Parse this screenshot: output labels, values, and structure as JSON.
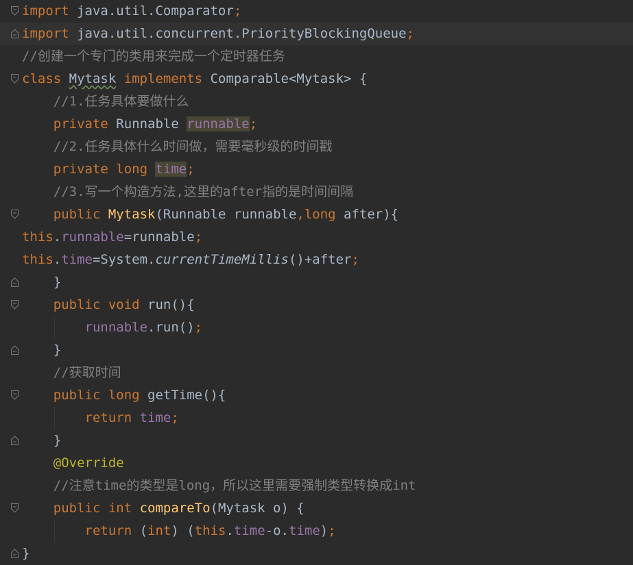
{
  "editor": {
    "lines": [
      {
        "segments": [
          {
            "c": "kw",
            "t": "import"
          },
          {
            "c": "plain",
            "t": " java.util.Comparator"
          },
          {
            "c": "kw",
            "t": ";"
          }
        ]
      },
      {
        "segments": [
          {
            "c": "kw",
            "t": "import"
          },
          {
            "c": "plain",
            "t": " java.util.concurrent.PriorityBlockingQueue"
          },
          {
            "c": "kw",
            "t": ";"
          }
        ]
      },
      {
        "segments": [
          {
            "c": "comment",
            "t": "//创建一个专门的类用来完成一个定时器任务"
          }
        ]
      },
      {
        "segments": [
          {
            "c": "kw",
            "t": "class "
          },
          {
            "c": "plain typo",
            "t": "Mytask"
          },
          {
            "c": "kw",
            "t": " implements "
          },
          {
            "c": "plain",
            "t": "Comparable<Mytask> {"
          }
        ]
      },
      {
        "segments": [
          {
            "c": "comment",
            "t": "    //1.任务具体要做什么"
          }
        ]
      },
      {
        "segments": [
          {
            "c": "kw",
            "t": "    private "
          },
          {
            "c": "plain",
            "t": "Runnable "
          },
          {
            "c": "field hl-usage",
            "t": "runnable"
          },
          {
            "c": "kw",
            "t": ";"
          }
        ]
      },
      {
        "segments": [
          {
            "c": "comment",
            "t": "    //2.任务具体什么时间做，需要毫秒级的时间戳"
          }
        ]
      },
      {
        "segments": [
          {
            "c": "kw",
            "t": "    private long "
          },
          {
            "c": "field hl-usage",
            "t": "time"
          },
          {
            "c": "kw",
            "t": ";"
          }
        ]
      },
      {
        "segments": [
          {
            "c": "comment",
            "t": "    //3.写一个构造方法,这里的after指的是时间间隔"
          }
        ]
      },
      {
        "segments": [
          {
            "c": "kw",
            "t": "    public "
          },
          {
            "c": "method",
            "t": "Mytask"
          },
          {
            "c": "plain",
            "t": "(Runnable runnable"
          },
          {
            "c": "kw",
            "t": ",long "
          },
          {
            "c": "plain",
            "t": "after){"
          }
        ]
      },
      {
        "segments": [
          {
            "c": "kw",
            "t": "this"
          },
          {
            "c": "plain",
            "t": "."
          },
          {
            "c": "field",
            "t": "runnable"
          },
          {
            "c": "plain",
            "t": "=runnable"
          },
          {
            "c": "kw",
            "t": ";"
          }
        ]
      },
      {
        "segments": [
          {
            "c": "kw",
            "t": "this"
          },
          {
            "c": "plain",
            "t": "."
          },
          {
            "c": "field",
            "t": "time"
          },
          {
            "c": "plain",
            "t": "=System."
          },
          {
            "c": "static-call",
            "t": "currentTimeMillis"
          },
          {
            "c": "plain",
            "t": "()+after"
          },
          {
            "c": "kw",
            "t": ";"
          }
        ]
      },
      {
        "segments": [
          {
            "c": "plain",
            "t": "    }"
          }
        ]
      },
      {
        "segments": [
          {
            "c": "kw",
            "t": "    public void "
          },
          {
            "c": "plain",
            "t": "run(){"
          }
        ]
      },
      {
        "segments": [
          {
            "c": "field",
            "t": "        runnable"
          },
          {
            "c": "plain",
            "t": ".run()"
          },
          {
            "c": "kw",
            "t": ";"
          }
        ]
      },
      {
        "segments": [
          {
            "c": "plain",
            "t": "    }"
          }
        ]
      },
      {
        "segments": [
          {
            "c": "comment",
            "t": "    //获取时间"
          }
        ]
      },
      {
        "segments": [
          {
            "c": "kw",
            "t": "    public long "
          },
          {
            "c": "plain",
            "t": "getTime(){"
          }
        ]
      },
      {
        "segments": [
          {
            "c": "kw",
            "t": "        return "
          },
          {
            "c": "field",
            "t": "time"
          },
          {
            "c": "kw",
            "t": ";"
          }
        ]
      },
      {
        "segments": [
          {
            "c": "plain",
            "t": "    }"
          }
        ]
      },
      {
        "segments": [
          {
            "c": "annot",
            "t": "    @Override"
          }
        ]
      },
      {
        "segments": [
          {
            "c": "comment",
            "t": "    //注意time的类型是long，所以这里需要强制类型转换成int"
          }
        ]
      },
      {
        "segments": [
          {
            "c": "kw",
            "t": "    public int "
          },
          {
            "c": "method",
            "t": "compareTo"
          },
          {
            "c": "plain",
            "t": "(Mytask o) {"
          }
        ]
      },
      {
        "segments": [
          {
            "c": "kw",
            "t": "        return "
          },
          {
            "c": "plain",
            "t": "("
          },
          {
            "c": "kw",
            "t": "int"
          },
          {
            "c": "plain",
            "t": ") ("
          },
          {
            "c": "kw",
            "t": "this"
          },
          {
            "c": "plain",
            "t": "."
          },
          {
            "c": "field",
            "t": "time"
          },
          {
            "c": "plain",
            "t": "-o."
          },
          {
            "c": "field",
            "t": "time"
          },
          {
            "c": "plain",
            "t": ")"
          },
          {
            "c": "kw",
            "t": ";"
          }
        ]
      },
      {
        "segments": [
          {
            "c": "plain",
            "t": "}"
          }
        ]
      }
    ],
    "folds": [
      {
        "line": 0,
        "dir": "open"
      },
      {
        "line": 1,
        "dir": "close"
      },
      {
        "line": 3,
        "dir": "open"
      },
      {
        "line": 9,
        "dir": "open"
      },
      {
        "line": 12,
        "dir": "close"
      },
      {
        "line": 13,
        "dir": "open"
      },
      {
        "line": 15,
        "dir": "close"
      },
      {
        "line": 17,
        "dir": "open"
      },
      {
        "line": 19,
        "dir": "close"
      },
      {
        "line": 22,
        "dir": "open"
      },
      {
        "line": 24,
        "dir": "close"
      }
    ],
    "current_line": 1,
    "colors": {
      "background": "#2b2b2b",
      "keyword": "#cc7832",
      "field": "#9876aa",
      "method": "#ffc66d",
      "comment": "#808080",
      "annotation": "#bbb529",
      "plain": "#a9b7c6"
    }
  }
}
